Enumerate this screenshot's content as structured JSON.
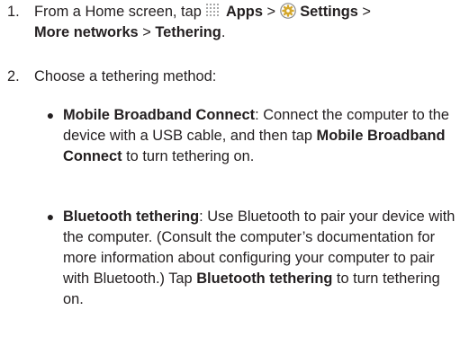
{
  "steps": [
    {
      "number": "1.",
      "prefix": "From a Home screen, tap ",
      "apps_label": "Apps",
      "sep1": " > ",
      "settings_label": "Settings",
      "sep2": " > ",
      "more_networks_label": "More networks",
      "sep3": " > ",
      "tethering_label": "Tethering",
      "end": ".",
      "apps_icon": "apps-grid-icon",
      "settings_icon": "settings-gear-icon"
    },
    {
      "number": "2.",
      "text": "Choose a tethering method:"
    }
  ],
  "methods": [
    {
      "bullet": "●",
      "title": "Mobile Broadband Connect",
      "desc_a": ": Connect the computer to the device with a USB cable, and then tap ",
      "tap_label": "Mobile Broadband Connect",
      "desc_b": " to turn tethering on."
    },
    {
      "bullet": "●",
      "title": "Bluetooth tethering",
      "desc_a": ": Use Bluetooth to pair your device with the computer. (Consult the computer’s documentation for more information about configuring your computer to pair with Bluetooth.) Tap ",
      "tap_label": "Bluetooth tethering",
      "desc_b": " to turn tethering on."
    }
  ],
  "colors": {
    "text": "#231f20",
    "icon_grey": "#8a8a8a",
    "icon_gold": "#d4a72c"
  }
}
